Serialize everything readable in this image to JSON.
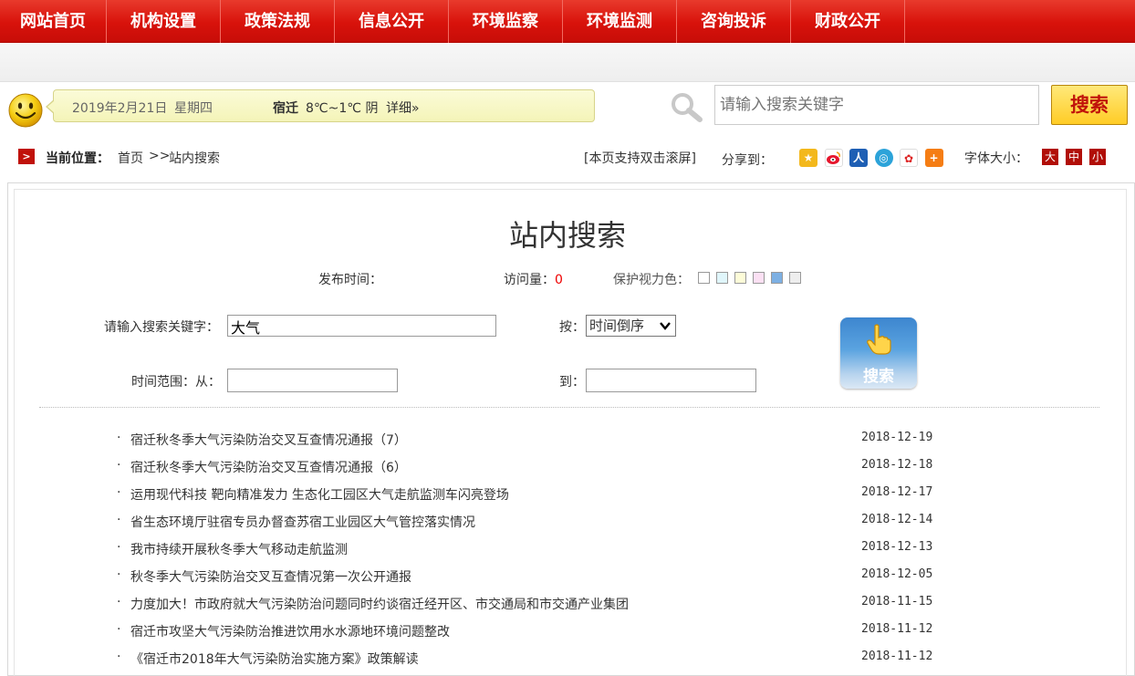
{
  "nav": {
    "items": [
      {
        "label": "网站首页"
      },
      {
        "label": "机构设置"
      },
      {
        "label": "政策法规"
      },
      {
        "label": "信息公开"
      },
      {
        "label": "环境监察"
      },
      {
        "label": "环境监测"
      },
      {
        "label": "咨询投诉"
      },
      {
        "label": "财政公开"
      }
    ]
  },
  "info_bar": {
    "date": "2019年2月21日",
    "weekday": "星期四",
    "city": "宿迁",
    "temperature": "8℃~1℃ 阴",
    "detail_link": "详细»"
  },
  "top_search": {
    "placeholder": "请输入搜索关键字",
    "button_label": "搜索"
  },
  "breadcrumb": {
    "label": "当前位置：",
    "home": "首页",
    "separator": ">>",
    "current": "站内搜索"
  },
  "toolbar": {
    "dblclick_note": "[本页支持双击滚屏]",
    "share_label": "分享到：",
    "font_size_label": "字体大小：",
    "font_sizes": [
      "大",
      "中",
      "小"
    ]
  },
  "page": {
    "title": "站内搜索",
    "publish_label": "发布时间：",
    "visits_label": "访问量：",
    "visits_count": "0",
    "eye_care_label": "保护视力色："
  },
  "search_form": {
    "keyword_label": "请输入搜索关键字：",
    "keyword_value": "大气",
    "sort_label": "按：",
    "sort_value": "时间倒序",
    "range_from_label": "时间范围：从：",
    "range_to_label": "到：",
    "submit_label": "搜索"
  },
  "results": [
    {
      "title": "宿迁秋冬季大气污染防治交叉互查情况通报（7）",
      "date": "2018-12-19"
    },
    {
      "title": "宿迁秋冬季大气污染防治交叉互查情况通报（6）",
      "date": "2018-12-18"
    },
    {
      "title": "运用现代科技 靶向精准发力 生态化工园区大气走航监测车闪亮登场",
      "date": "2018-12-17"
    },
    {
      "title": "省生态环境厅驻宿专员办督查苏宿工业园区大气管控落实情况",
      "date": "2018-12-14"
    },
    {
      "title": "我市持续开展秋冬季大气移动走航监测",
      "date": "2018-12-13"
    },
    {
      "title": "秋冬季大气污染防治交叉互查情况第一次公开通报",
      "date": "2018-12-05"
    },
    {
      "title": "力度加大！市政府就大气污染防治问题同时约谈宿迁经开区、市交通局和市交通产业集团",
      "date": "2018-11-15"
    },
    {
      "title": "宿迁市攻坚大气污染防治推进饮用水水源地环境问题整改",
      "date": "2018-11-12"
    },
    {
      "title": "《宿迁市2018年大气污染防治实施方案》政策解读",
      "date": "2018-11-12"
    }
  ],
  "colors": {
    "nav_red": "#d8120b",
    "visits_count_red": "#ee0000",
    "eye_care_swatches": [
      "#ffffff",
      "#e0f6fb",
      "#fdfcd8",
      "#fbe0f3",
      "#7db0e3",
      "#eeeeee"
    ]
  },
  "icons": {
    "share": [
      "qzone-icon",
      "weibo-icon",
      "renren-icon",
      "tencent-weibo-icon",
      "baidu-icon",
      "more-share-icon"
    ]
  }
}
